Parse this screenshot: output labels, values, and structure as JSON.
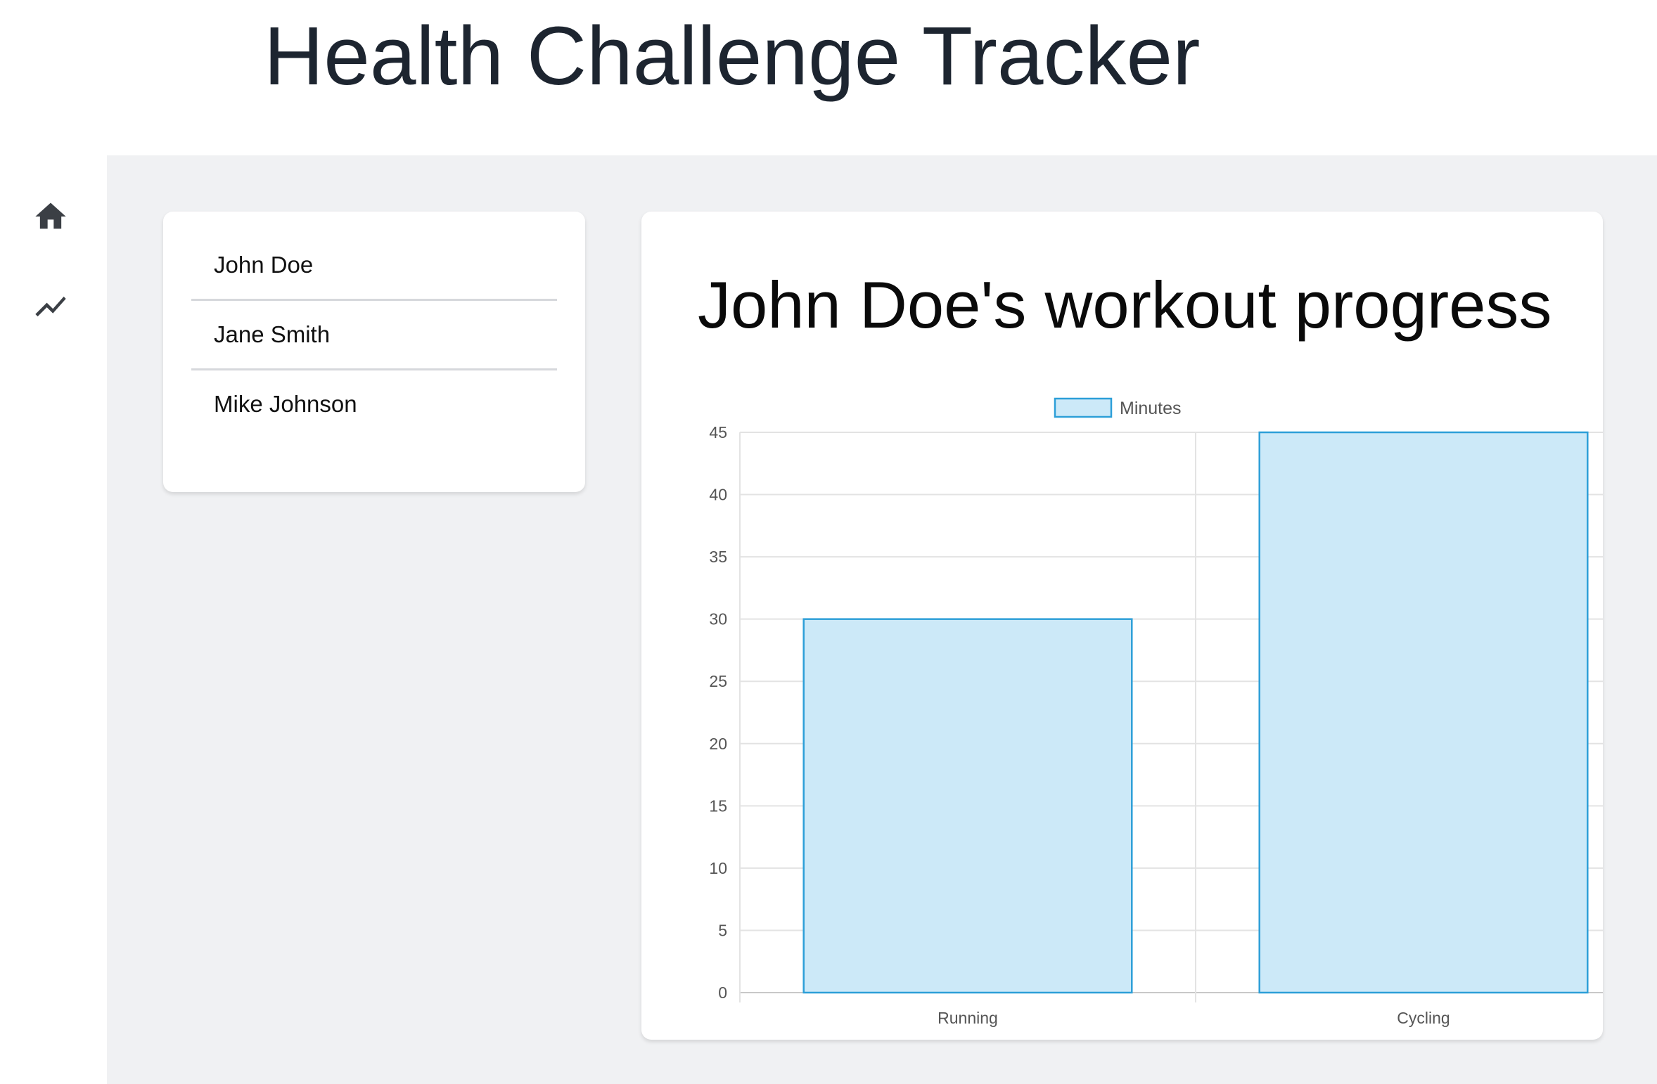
{
  "app": {
    "title": "Health Challenge Tracker"
  },
  "sidebar": {
    "items": [
      {
        "icon": "home-icon",
        "label": ""
      },
      {
        "icon": "trending-up-icon",
        "label": ""
      }
    ]
  },
  "users": {
    "items": [
      "John Doe",
      "Jane Smith",
      "Mike Johnson"
    ]
  },
  "chart_panel": {
    "title": "John Doe's workout progress"
  },
  "colors": {
    "bar_fill": "#cce9f8",
    "bar_stroke": "#2d9fd8",
    "grid": "#e3e3e3",
    "background": "#f0f1f3"
  },
  "chart_data": {
    "type": "bar",
    "categories": [
      "Running",
      "Cycling"
    ],
    "series": [
      {
        "name": "Minutes",
        "values": [
          30,
          45
        ]
      }
    ],
    "title": "",
    "xlabel": "",
    "ylabel": "",
    "ylim": [
      0,
      45
    ],
    "yticks": [
      0,
      5,
      10,
      15,
      20,
      25,
      30,
      35,
      40,
      45
    ],
    "grid": true,
    "legend": "top-center"
  }
}
